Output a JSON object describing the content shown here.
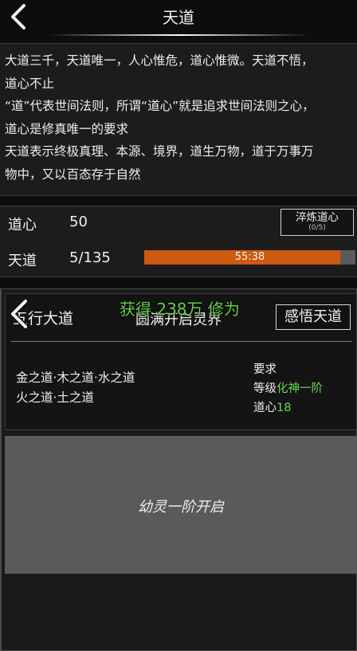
{
  "header": {
    "title": "天道"
  },
  "description": {
    "lines": [
      "大道三千，天道唯一，人心惟危，道心惟微。天道不悟，",
      "道心不止",
      "“道”代表世间法则，所谓“道心”就是追求世间法则之心，",
      "道心是修真唯一的要求",
      "天道表示终极真理、本源、境界，道生万物，道于万事万",
      "物中，又以百态存于自然"
    ]
  },
  "stats": {
    "daoxin": {
      "label": "道心",
      "value": "50"
    },
    "tiandao": {
      "label": "天道",
      "value": "5/135",
      "progress_text": "55:38",
      "progress_fraction": 0.93,
      "bar_color": "#cc5a10"
    },
    "refine_button": {
      "label": "淬炼道心",
      "count": "(0/5)"
    }
  },
  "detail": {
    "title": "五行大道",
    "realm_text": "圆满开启灵界",
    "toast": "获得 238万 修为",
    "enlighten_button": "感悟天道",
    "dao_lines": [
      "金之道·木之道·水之道",
      "火之道·土之道"
    ],
    "requirements": {
      "heading": "要求",
      "level_label": "等级",
      "level_value": "化神一阶",
      "daoxin_label": "道心",
      "daoxin_value": "18"
    },
    "image_caption": "幼灵一阶开启"
  },
  "colors": {
    "accent_green": "#6bd84e",
    "progress_orange": "#cc5a10",
    "background": "#0d0d0d"
  }
}
